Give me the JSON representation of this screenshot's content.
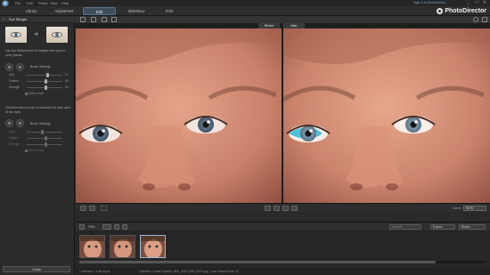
{
  "titlebar": {
    "menu": [
      "File",
      "Edit",
      "Photo",
      "View",
      "Help"
    ],
    "signin": "Sign in to DirectorZone",
    "controls": [
      "_",
      "□",
      "✕"
    ]
  },
  "tabs": [
    {
      "label": "Library"
    },
    {
      "label": "Adjustment"
    },
    {
      "label": "Edit"
    },
    {
      "label": "Slideshow"
    },
    {
      "label": "Print"
    }
  ],
  "brand": "PhotoDirector",
  "panel": {
    "title": "Eye Blinger",
    "desc1": "Use the below brush to brighten the eyes in your photos.",
    "brush_settings": "Brush Settings",
    "sliders1": [
      {
        "label": "Size",
        "value": "27",
        "level": 0.55
      },
      {
        "label": "Feather",
        "value": "50",
        "level": 0.5
      },
      {
        "label": "Strength",
        "value": "50",
        "level": 0.5
      }
    ],
    "auto_adjust": "Edit or more",
    "desc2": "Click the below brush to enhance the dark area of the eyes.",
    "brush_settings2": "Brush Settings",
    "sliders2": [
      {
        "label": "Size",
        "value": "",
        "level": 0.4
      },
      {
        "label": "Feather",
        "value": "",
        "level": 0.5
      },
      {
        "label": "Strength",
        "value": "",
        "level": 0.5
      }
    ],
    "auto_adjust2": "Edit or more",
    "close": "Close"
  },
  "viewer": {
    "before_label": "Before",
    "after_label": "After",
    "zoom_label": "Zoom:",
    "zoom_value": "95 %"
  },
  "filmstrip": {
    "filter_label": "Filter:",
    "search_placeholder": "Search",
    "export_label": "Export...",
    "share_label": "Share...",
    "status_left": "1 selected - 3 displayed",
    "status_mid": "Collection: Latest Imports | IMG_5321 (IMG_5321.jpg) | Last Viewed Date: 19"
  },
  "colors": {
    "accent": "#5a6f85",
    "brush_cyan": "#2fb8d8"
  }
}
